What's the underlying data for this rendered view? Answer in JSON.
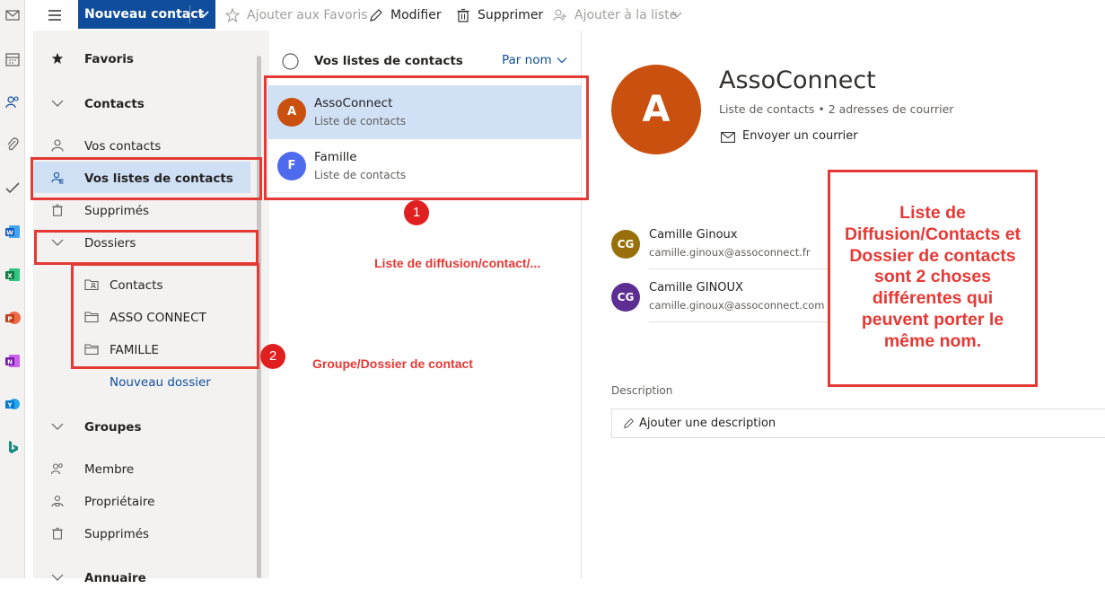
{
  "toolbar": {
    "new_contact": "Nouveau contact",
    "add_favorites": "Ajouter aux Favoris",
    "edit": "Modifier",
    "delete": "Supprimer",
    "add_to_list": "Ajouter à la liste"
  },
  "rail": {
    "icons": [
      "mail-icon",
      "calendar-icon",
      "people-icon",
      "attachment-icon",
      "todo-icon",
      "word-icon",
      "excel-icon",
      "powerpoint-icon",
      "onenote-icon",
      "yammer-icon",
      "bing-icon"
    ]
  },
  "nav": {
    "favorites": "Favoris",
    "contacts_header": "Contacts",
    "your_contacts": "Vos contacts",
    "your_contact_lists": "Vos listes de contacts",
    "deleted": "Supprimés",
    "folders_header": "Dossiers",
    "folders": [
      "Contacts",
      "ASSO CONNECT",
      "FAMILLE"
    ],
    "new_folder": "Nouveau dossier",
    "groups_header": "Groupes",
    "member": "Membre",
    "owner": "Propriétaire",
    "groups_deleted": "Supprimés",
    "directory_header": "Annuaire"
  },
  "list": {
    "header": "Vos listes de contacts",
    "sort": "Par nom",
    "items": [
      {
        "initial": "A",
        "name": "AssoConnect",
        "subtitle": "Liste de contacts",
        "color": "#ca5010"
      },
      {
        "initial": "F",
        "name": "Famille",
        "subtitle": "Liste de contacts",
        "color": "#4f6bed"
      }
    ]
  },
  "detail": {
    "initial": "A",
    "title": "AssoConnect",
    "subtitle": "Liste de contacts • 2 adresses de courrier",
    "send_mail": "Envoyer un courrier",
    "members": [
      {
        "initials": "CG",
        "name": "Camille Ginoux",
        "email": "camille.ginoux@assoconnect.fr",
        "color": "#986f0b"
      },
      {
        "initials": "CG",
        "name": "Camille GINOUX",
        "email": "camille.ginoux@assoconnect.com",
        "color": "#5c2e91"
      }
    ],
    "description_label": "Description",
    "add_description": "Ajouter une description"
  },
  "annotations": {
    "badge1": "1",
    "badge2": "2",
    "label1": "Liste de diffusion/contact/...",
    "label2": "Groupe/Dossier de contact",
    "note": [
      "Liste de",
      "Diffusion/Contacts et",
      "Dossier de contacts",
      "sont 2 choses",
      "différentes qui",
      "peuvent porter le",
      "même nom."
    ]
  },
  "colors": {
    "accent": "#0f4d9c",
    "annotation_red": "#e53935",
    "selected_bg": "#cfe0f5",
    "nav_bg": "#f3f2f1"
  }
}
